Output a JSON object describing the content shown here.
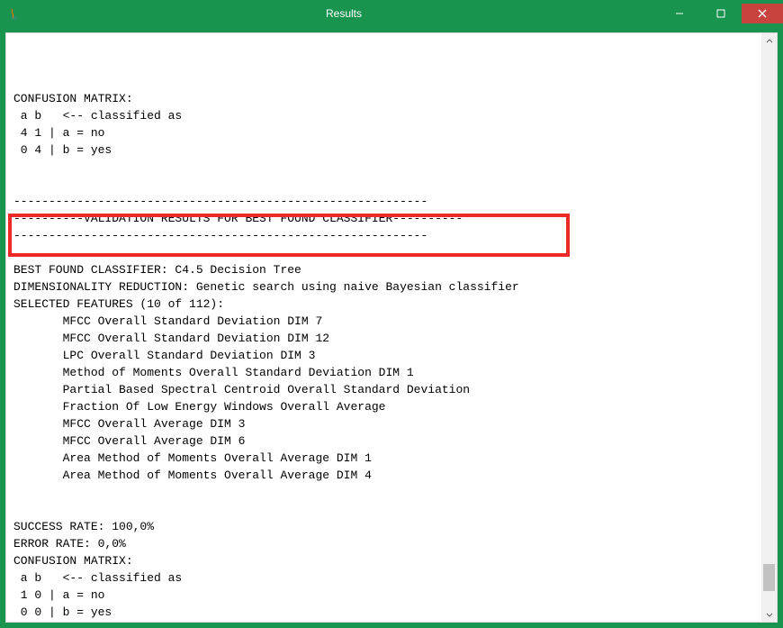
{
  "window": {
    "title": "Results"
  },
  "content": {
    "header_line": "",
    "confusion_header": "CONFUSION MATRIX:",
    "cm1_line1": " a b   <-- classified as",
    "cm1_line2": " 4 1 | a = no",
    "cm1_line3": " 0 4 | b = yes",
    "dashline": "-----------------------------------------------------------",
    "validation_header": "----------VALIDATION RESULTS FOR BEST FOUND CLASSIFIER----------",
    "best_classifier": "BEST FOUND CLASSIFIER: C4.5 Decision Tree",
    "dim_reduction": "DIMENSIONALITY REDUCTION: Genetic search using naive Bayesian classifier",
    "selected_features_header": "SELECTED FEATURES (10 of 112):",
    "features": [
      "       MFCC Overall Standard Deviation DIM 7",
      "       MFCC Overall Standard Deviation DIM 12",
      "       LPC Overall Standard Deviation DIM 3",
      "       Method of Moments Overall Standard Deviation DIM 1",
      "       Partial Based Spectral Centroid Overall Standard Deviation",
      "       Fraction Of Low Energy Windows Overall Average",
      "       MFCC Overall Average DIM 3",
      "       MFCC Overall Average DIM 6",
      "       Area Method of Moments Overall Average DIM 1",
      "       Area Method of Moments Overall Average DIM 4"
    ],
    "success_rate": "SUCCESS RATE: 100,0%",
    "error_rate": "ERROR RATE: 0,0%",
    "confusion_header2": "CONFUSION MATRIX:",
    "cm2_line1": " a b   <-- classified as",
    "cm2_line2": " 1 0 | a = no",
    "cm2_line3": " 0 0 | b = yes"
  },
  "icons": {
    "app": "java-icon",
    "minimize": "minimize-icon",
    "maximize": "maximize-icon",
    "close": "close-icon",
    "scroll_up": "chevron-up-icon",
    "scroll_down": "chevron-down-icon"
  }
}
